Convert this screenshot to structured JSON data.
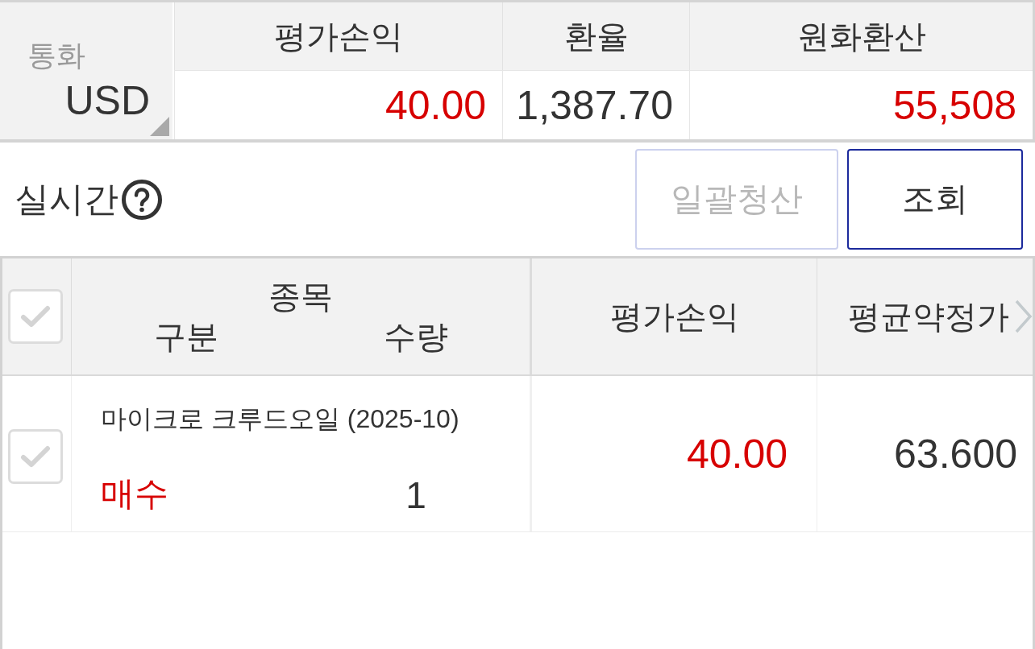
{
  "summary": {
    "currency": {
      "label": "통화",
      "value": "USD"
    },
    "columns": [
      {
        "header": "평가손익",
        "value": "40.00",
        "color": "#d70000"
      },
      {
        "header": "환율",
        "value": "1,387.70",
        "color": "#333333"
      },
      {
        "header": "원화환산",
        "value": "55,508",
        "color": "#d70000"
      }
    ]
  },
  "toolbar": {
    "label": "실시간",
    "buttons": [
      {
        "label": "일괄청산",
        "disabled": true
      },
      {
        "label": "조회",
        "disabled": false
      }
    ]
  },
  "positions": {
    "select_all": {
      "checked": false
    },
    "headers": {
      "product": "종목",
      "side": "구분",
      "quantity": "수량",
      "pnl": "평가손익",
      "avg_price": "평균약정가"
    },
    "rows": [
      {
        "checked": false,
        "product": "마이크로 크루드오일 (2025-10)",
        "side": {
          "text": "매수",
          "color": "#d70000"
        },
        "quantity": "1",
        "pnl": {
          "text": "40.00",
          "color": "#d70000"
        },
        "avg_price": "63.600"
      }
    ]
  }
}
